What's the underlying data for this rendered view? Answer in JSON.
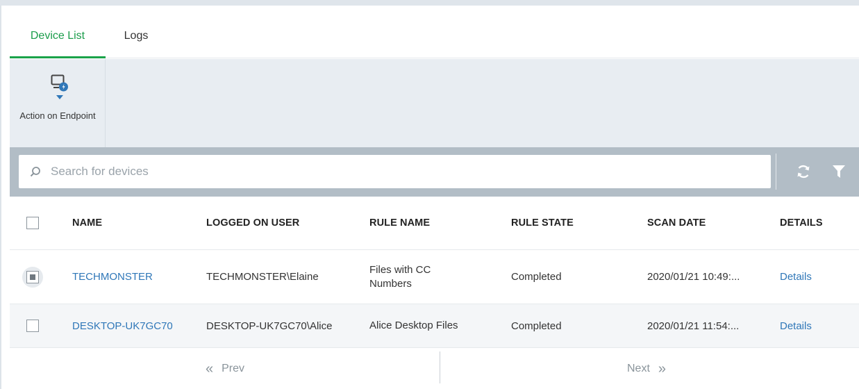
{
  "tabs": [
    {
      "label": "Device List",
      "active": true
    },
    {
      "label": "Logs",
      "active": false
    }
  ],
  "toolbar": {
    "action_label": "Action on Endpoint",
    "action_icon": "monitor-gear-icon"
  },
  "search": {
    "placeholder": "Search for devices",
    "value": ""
  },
  "table": {
    "columns": [
      "NAME",
      "LOGGED ON USER",
      "RULE NAME",
      "RULE STATE",
      "SCAN DATE",
      "DETAILS"
    ],
    "rows": [
      {
        "name": "TECHMONSTER",
        "logged_on_user": "TECHMONSTER\\Elaine",
        "rule_name": "Files with CC Numbers",
        "rule_state": "Completed",
        "scan_date": "2020/01/21 10:49:...",
        "details": "Details"
      },
      {
        "name": "DESKTOP-UK7GC70",
        "logged_on_user": "DESKTOP-UK7GC70\\Alice",
        "rule_name": "Alice Desktop Files",
        "rule_state": "Completed",
        "scan_date": "2020/01/21 11:54:...",
        "details": "Details"
      }
    ]
  },
  "pager": {
    "prev_label": "Prev",
    "next_label": "Next"
  },
  "colors": {
    "accent_green": "#1aa34a",
    "link_blue": "#2f77b8",
    "icon_blue": "#2f77b8",
    "toolbar_bg": "#e8edf2",
    "search_band_bg": "#b2bdc6"
  }
}
